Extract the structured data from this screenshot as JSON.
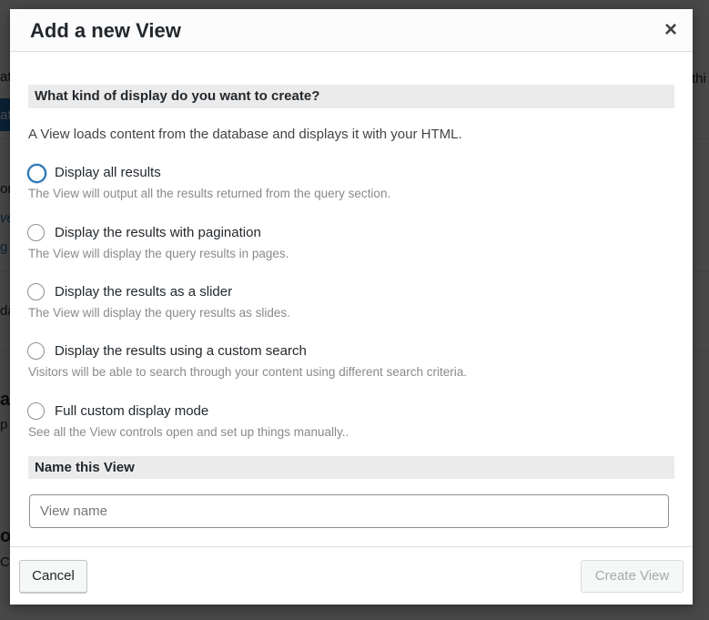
{
  "background": {
    "fragments": [
      "ate",
      "thi",
      "at",
      "on",
      "ver",
      "g",
      "da",
      "ar",
      "p",
      "op",
      "C"
    ]
  },
  "dialog": {
    "title": "Add a new View",
    "close_symbol": "×",
    "kind_heading": "What kind of display do you want to create?",
    "intro": "A View loads content from the database and displays it with your HTML.",
    "options": [
      {
        "label": "Display all results",
        "description": "The View will output all the results returned from the query section.",
        "checked": false,
        "focused": true
      },
      {
        "label": "Display the results with pagination",
        "description": "The View will display the query results in pages.",
        "checked": false,
        "focused": false
      },
      {
        "label": "Display the results as a slider",
        "description": "The View will display the query results as slides.",
        "checked": false,
        "focused": false
      },
      {
        "label": "Display the results using a custom search",
        "description": "Visitors will be able to search through your content using different search criteria.",
        "checked": false,
        "focused": false
      },
      {
        "label": "Full custom display mode",
        "description": "See all the View controls open and set up things manually..",
        "checked": false,
        "focused": false
      }
    ],
    "name_heading": "Name this View",
    "name_input": {
      "value": "",
      "placeholder": "View name"
    },
    "cancel_label": "Cancel",
    "create_label": "Create View"
  },
  "colors": {
    "accent_focus": "#2271b1",
    "overlay": "#000000"
  }
}
